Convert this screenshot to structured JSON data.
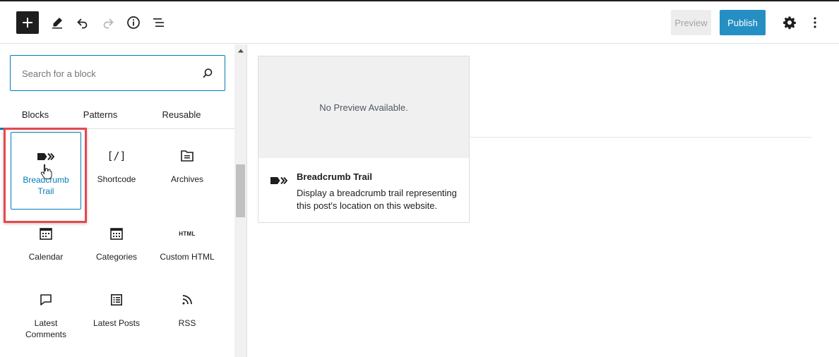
{
  "toolbar": {
    "add_icon": "plus-icon",
    "tools_icon": "pencil-icon",
    "undo_icon": "undo-icon",
    "redo_icon": "redo-icon",
    "info_icon": "info-icon",
    "outline_icon": "list-view-icon",
    "preview_label": "Preview",
    "publish_label": "Publish",
    "settings_icon": "gear-icon",
    "more_icon": "more-vertical-icon"
  },
  "inserter": {
    "search": {
      "placeholder": "Search for a block",
      "value": ""
    },
    "tabs": [
      {
        "label": "Blocks",
        "active": true
      },
      {
        "label": "Patterns",
        "active": false
      },
      {
        "label": "Reusable",
        "active": false
      }
    ],
    "blocks": [
      {
        "label": "Breadcrumb Trail",
        "icon": "breadcrumb-icon",
        "selected": true
      },
      {
        "label": "Shortcode",
        "icon": "shortcode-icon"
      },
      {
        "label": "Archives",
        "icon": "archives-icon"
      },
      {
        "label": "Calendar",
        "icon": "calendar-icon"
      },
      {
        "label": "Categories",
        "icon": "categories-icon"
      },
      {
        "label": "Custom HTML",
        "icon": "html-icon"
      },
      {
        "label": "Latest Comments",
        "icon": "comment-icon"
      },
      {
        "label": "Latest Posts",
        "icon": "list-icon"
      },
      {
        "label": "RSS",
        "icon": "rss-icon"
      }
    ],
    "html_icon_text": "HTML",
    "shortcode_icon_text": "[/]"
  },
  "preview": {
    "no_preview_text": "No Preview Available.",
    "block_title": "Breadcrumb Trail",
    "block_description": "Display a breadcrumb trail representing this post's location on this website."
  },
  "colors": {
    "accent": "#007cba",
    "highlight": "#e8474b",
    "text": "#1e1e1e"
  }
}
